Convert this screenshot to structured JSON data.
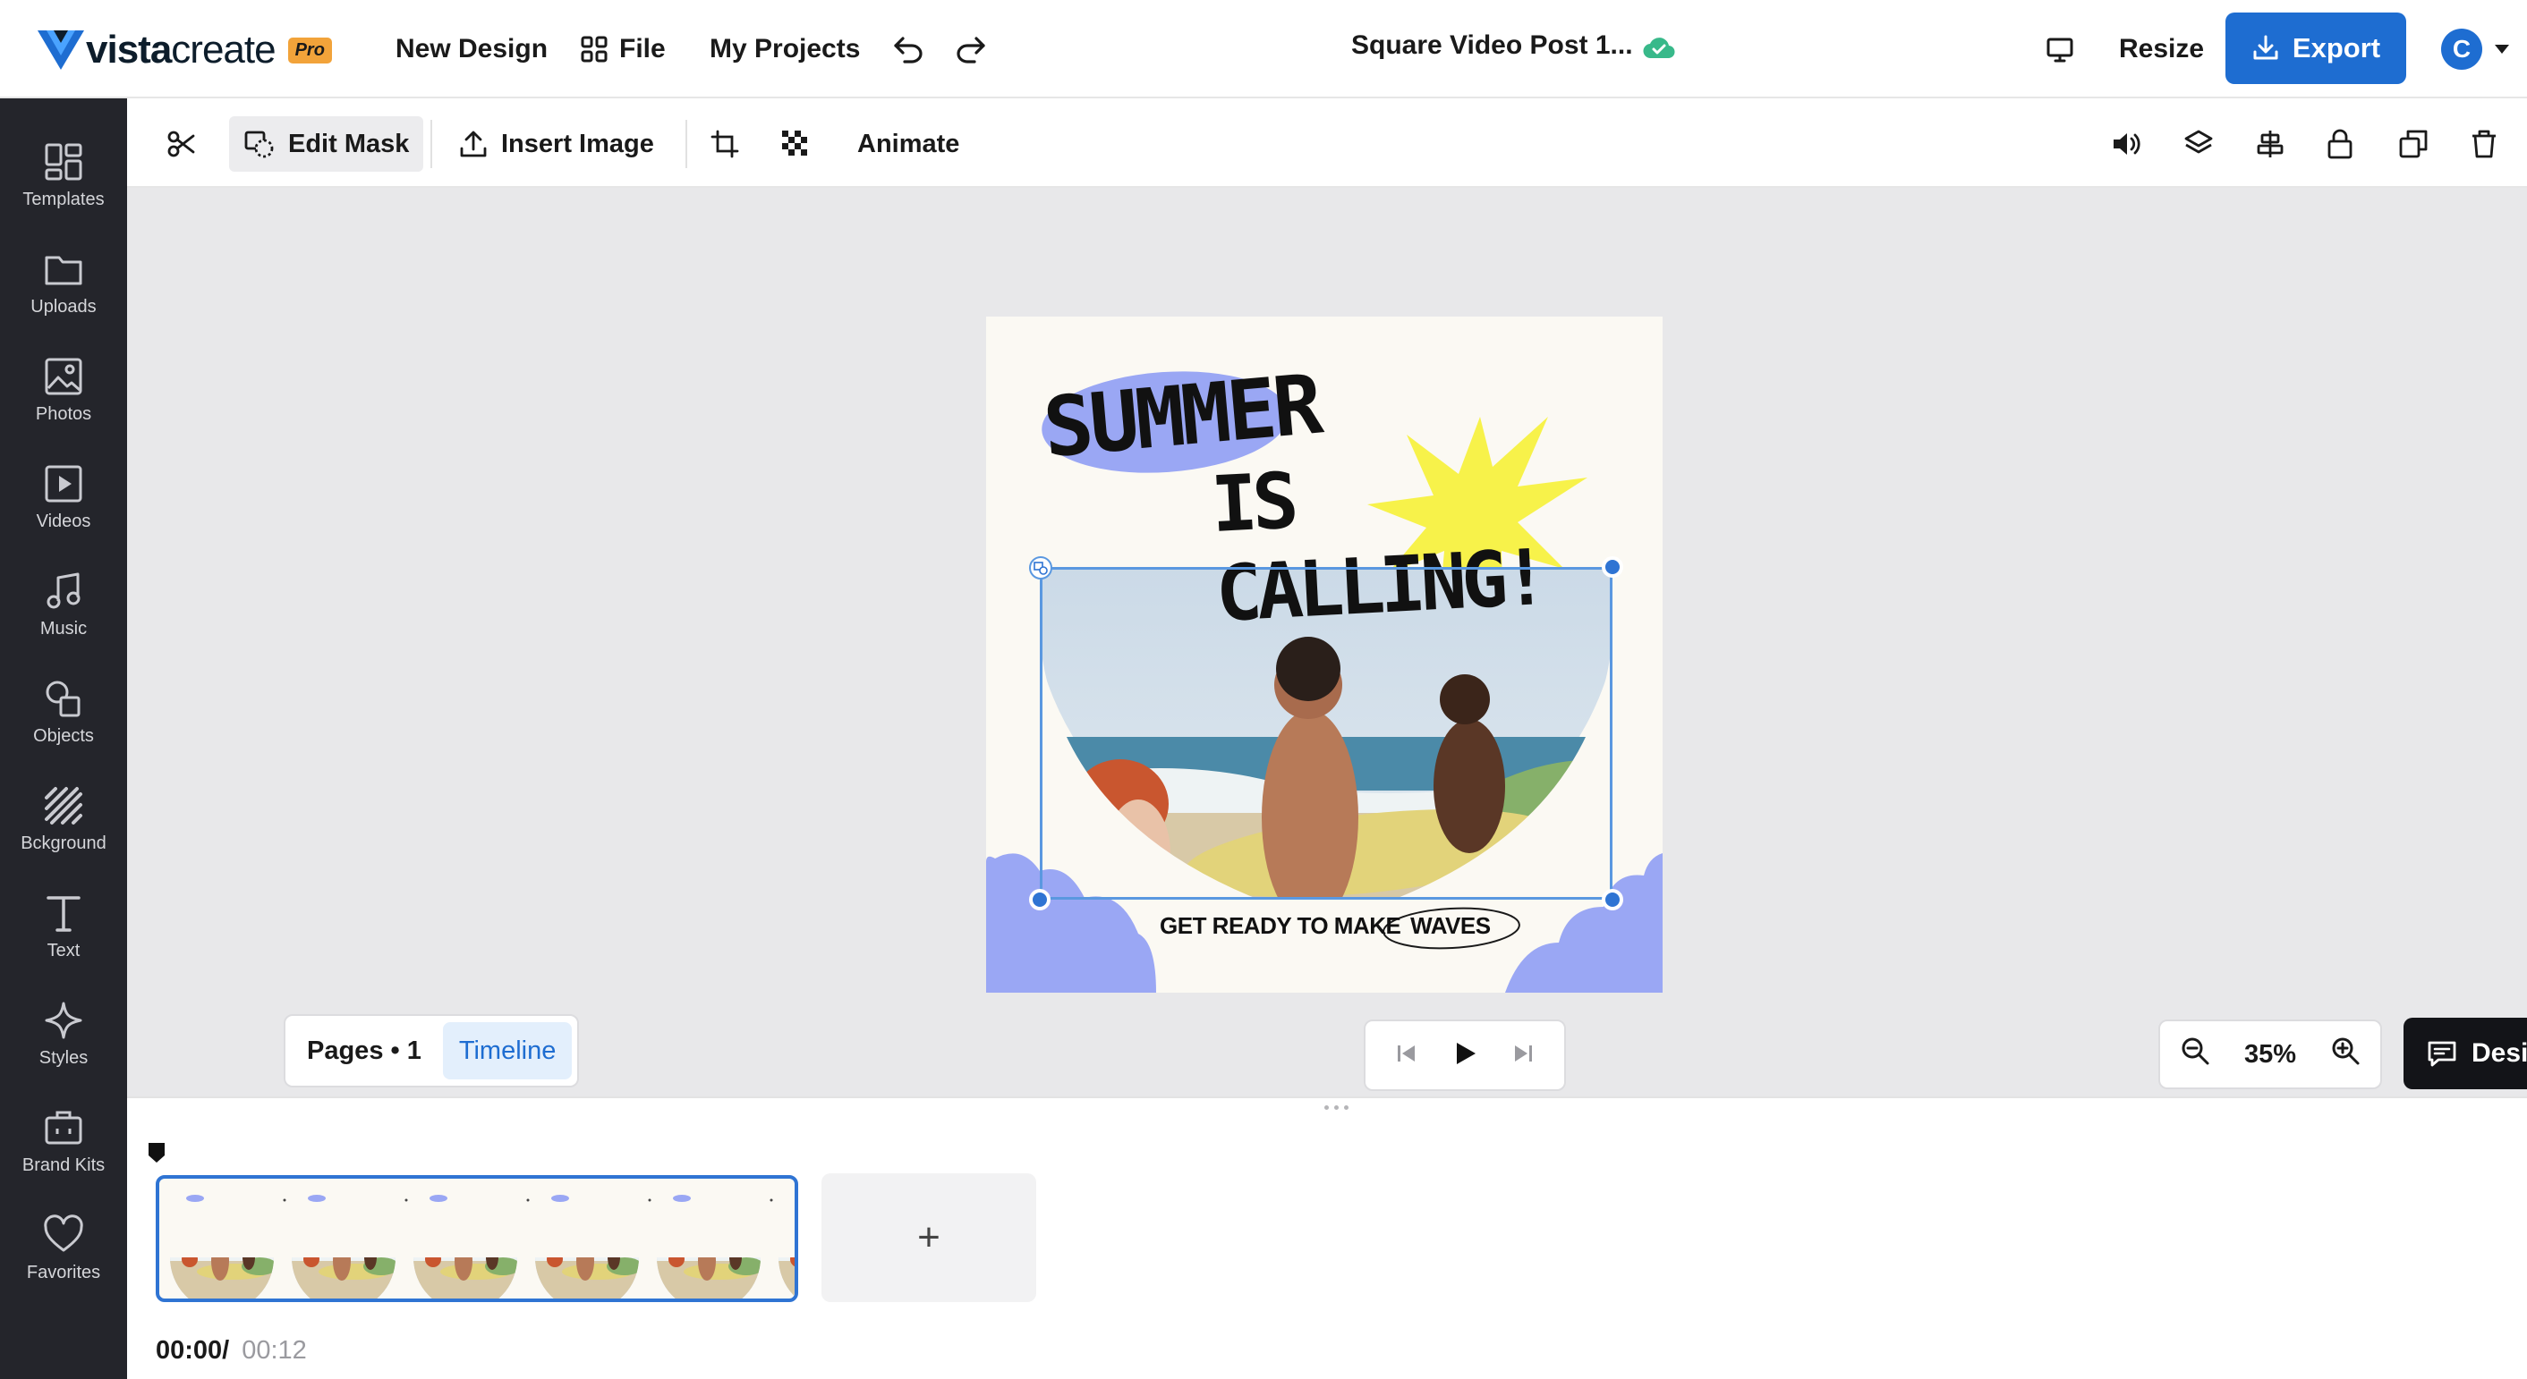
{
  "header": {
    "logo_bold": "vista",
    "logo_light": "create",
    "pro_badge": "Pro",
    "new_design": "New Design",
    "file": "File",
    "my_projects": "My Projects",
    "doc_title": "Square Video Post 1...",
    "resize": "Resize",
    "export": "Export",
    "avatar_initial": "C"
  },
  "sidebar": {
    "items": [
      {
        "label": "Templates",
        "icon": "templates-icon"
      },
      {
        "label": "Uploads",
        "icon": "folder-icon"
      },
      {
        "label": "Photos",
        "icon": "image-icon"
      },
      {
        "label": "Videos",
        "icon": "video-icon"
      },
      {
        "label": "Music",
        "icon": "music-icon"
      },
      {
        "label": "Objects",
        "icon": "shapes-icon"
      },
      {
        "label": "Bckground",
        "icon": "background-icon"
      },
      {
        "label": "Text",
        "icon": "text-icon"
      },
      {
        "label": "Styles",
        "icon": "sparkle-icon"
      },
      {
        "label": "Brand Kits",
        "icon": "briefcase-icon"
      },
      {
        "label": "Favorites",
        "icon": "heart-icon"
      }
    ]
  },
  "toolbar": {
    "edit_mask": "Edit Mask",
    "insert_image": "Insert Image",
    "animate": "Animate"
  },
  "design": {
    "headline_1": "SUMMER",
    "headline_2": "IS CALLING!",
    "tagline": "GET READY TO MAKE",
    "tagline_highlight": "WAVES",
    "accent_color": "#9aa7f4",
    "star_color": "#f7f24a"
  },
  "canvas_controls": {
    "pages": "Pages • 1",
    "timeline": "Timeline",
    "zoom": "35%",
    "design_help": "Design help"
  },
  "timeline": {
    "current_time": "00:00/",
    "duration": "00:12",
    "add_page": "+"
  },
  "colors": {
    "primary": "#1e6dd1",
    "sidebar_bg": "#24252b"
  }
}
